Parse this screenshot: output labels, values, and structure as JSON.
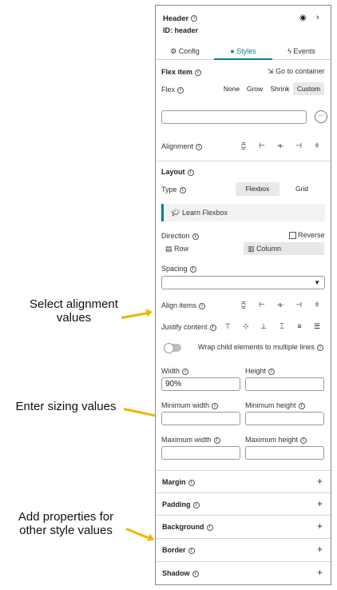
{
  "header": {
    "title": "Header",
    "id_label": "ID: header",
    "eye_icon": "eye-icon",
    "chevron_icon": "chevron-right-icon"
  },
  "tabs": [
    {
      "label": "Config",
      "icon": "gear-icon"
    },
    {
      "label": "Styles",
      "icon": "palette-icon"
    },
    {
      "label": "Events",
      "icon": "bolt-icon"
    }
  ],
  "flex_item": {
    "title": "Flex item",
    "go_container": "Go to container",
    "flex_label": "Flex",
    "options": [
      "None",
      "Grow",
      "Shrink",
      "Custom"
    ],
    "selected": "Custom",
    "alignment_label": "Alignment"
  },
  "layout": {
    "title": "Layout",
    "type_label": "Type",
    "type_options": [
      "Flexbox",
      "Grid"
    ],
    "type_selected": "Flexbox",
    "learn": "Learn Flexbox",
    "direction_label": "Direction",
    "reverse_label": "Reverse",
    "row_label": "Row",
    "column_label": "Column",
    "direction_selected": "Column",
    "spacing_label": "Spacing",
    "align_items_label": "Align items",
    "justify_label": "Justify content",
    "wrap_label": "Wrap child elements to multiple lines",
    "wrap_on": false,
    "width_label": "Width",
    "width_value": "90%",
    "height_label": "Height",
    "min_width_label": "Minimum width",
    "min_height_label": "Minimum height",
    "max_width_label": "Maximum width",
    "max_height_label": "Maximum height"
  },
  "sections": [
    "Margin",
    "Padding",
    "Background",
    "Border",
    "Shadow"
  ],
  "annotations": {
    "alignment": "Select alignment values",
    "sizing": "Enter sizing values",
    "properties": "Add properties for other style values"
  },
  "colors": {
    "accent": "#0d7c8c",
    "arrow": "#f0b400"
  }
}
